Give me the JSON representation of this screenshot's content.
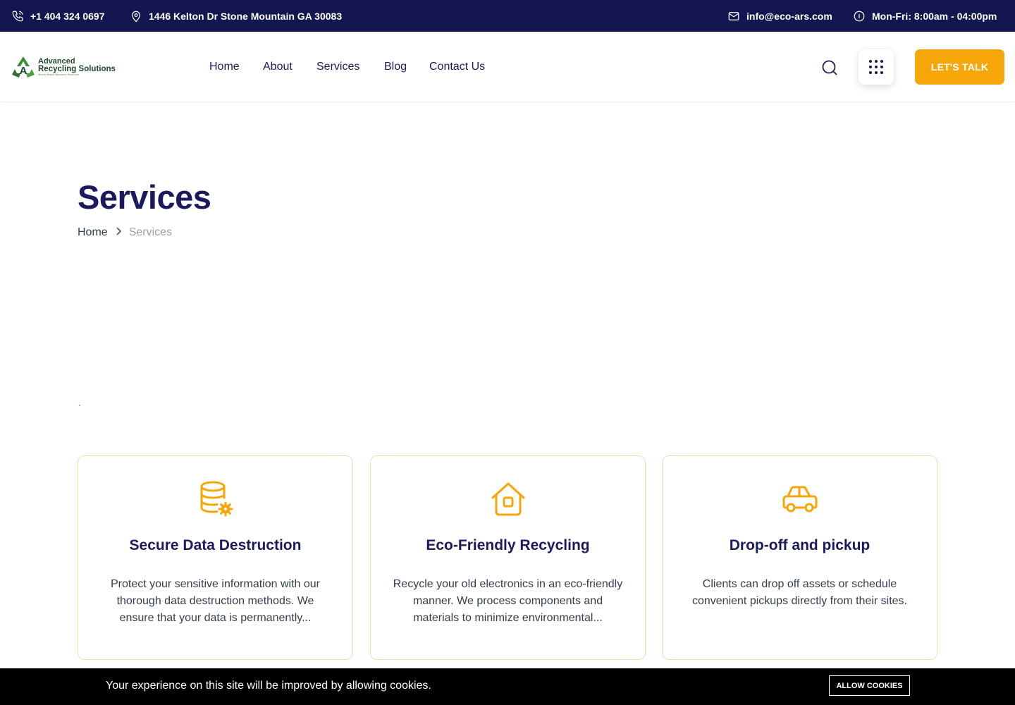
{
  "topbar": {
    "phone": "+1 404 324 0697",
    "address": "1446 Kelton Dr Stone Mountain GA 30083",
    "email": "info@eco-ars.com",
    "hours": "Mon-Fri: 8:00am - 04:00pm"
  },
  "logo": {
    "line1": "Advanced",
    "line2": "Recycling Solutions",
    "line3": "Where Waste Becomes Resource"
  },
  "nav": {
    "items": [
      "Home",
      "About",
      "Services",
      "Blog",
      "Contact Us"
    ]
  },
  "header": {
    "cta_label": "LET'S TALK"
  },
  "hero": {
    "title": "Services",
    "breadcrumb_home": "Home",
    "breadcrumb_current": "Services",
    "stray_char": "`"
  },
  "cards": [
    {
      "icon": "database-gear-icon",
      "title": "Secure Data Destruction",
      "description": "Protect your sensitive information with our thorough data destruction methods. We ensure that your data is permanently..."
    },
    {
      "icon": "house-icon",
      "title": "Eco-Friendly Recycling",
      "description": "Recycle your old electronics in an eco-friendly manner. We process components and materials to minimize environmental..."
    },
    {
      "icon": "car-icon",
      "title": "Drop-off and pickup",
      "description": "Clients can drop off assets or schedule convenient pickups directly from their sites."
    }
  ],
  "cookie": {
    "message": "Your experience on this site will be improved by allowing cookies.",
    "button_label": "ALLOW COOKIES"
  },
  "colors": {
    "topbar_bg": "#141650",
    "accent": "#f6a609",
    "heading": "#1b1a5e"
  }
}
